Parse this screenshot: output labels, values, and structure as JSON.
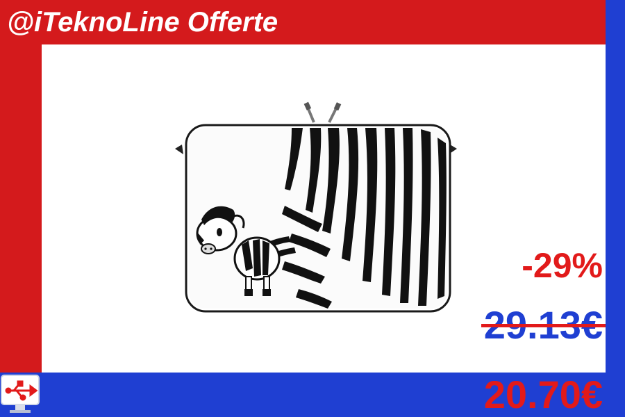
{
  "header": {
    "brand_title": "@iTeknoLine Offerte"
  },
  "product": {
    "image_icon": "zebra-laptop-sleeve-image"
  },
  "pricing": {
    "discount": "-29%",
    "old_price": "29.13€",
    "new_price": "20.70€"
  },
  "colors": {
    "red": "#d41a1c",
    "blue": "#1f3fd2",
    "price_red": "#e21a1a"
  },
  "logo": {
    "icon": "computer-usb-logo-icon"
  }
}
